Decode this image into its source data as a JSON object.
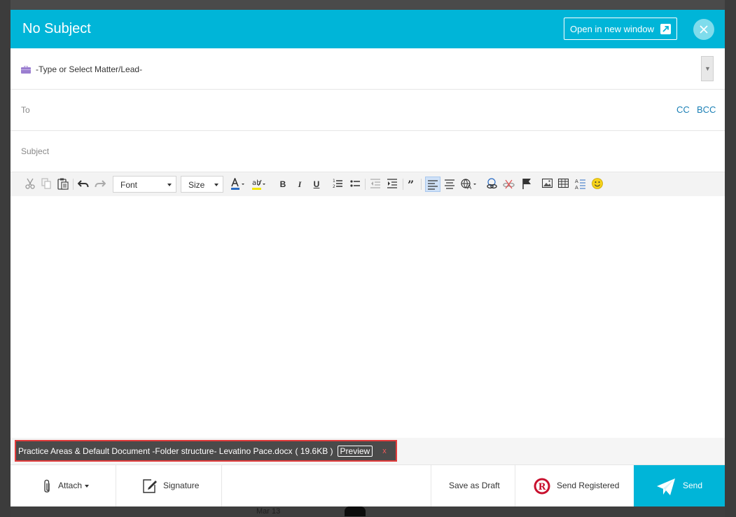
{
  "dialog": {
    "title": "No Subject",
    "open_new_window_label": "Open in new window"
  },
  "matter": {
    "placeholder": "-Type or Select Matter/Lead-"
  },
  "recipients": {
    "to_label": "To",
    "cc_label": "CC",
    "bcc_label": "BCC"
  },
  "subject": {
    "label": "Subject"
  },
  "toolbar": {
    "font_select": "Font",
    "size_select": "Size",
    "bold": "B",
    "italic": "I",
    "underline": "U"
  },
  "attachment": {
    "name": "Practice Areas & Default Document -Folder structure- Levatino Pace.docx",
    "size": "( 19.6KB )",
    "preview_label": "Preview",
    "remove_label": "x"
  },
  "footer": {
    "attach_label": "Attach",
    "signature_label": "Signature",
    "save_draft_label": "Save as Draft",
    "send_registered_label": "Send Registered",
    "send_label": "Send"
  },
  "background": {
    "date_label": "Mar 13"
  },
  "colors": {
    "accent": "#00b5d8",
    "attachment_chip": "#4a4a4a",
    "attachment_highlight": "#e23b3b",
    "link": "#1a7fb5"
  }
}
